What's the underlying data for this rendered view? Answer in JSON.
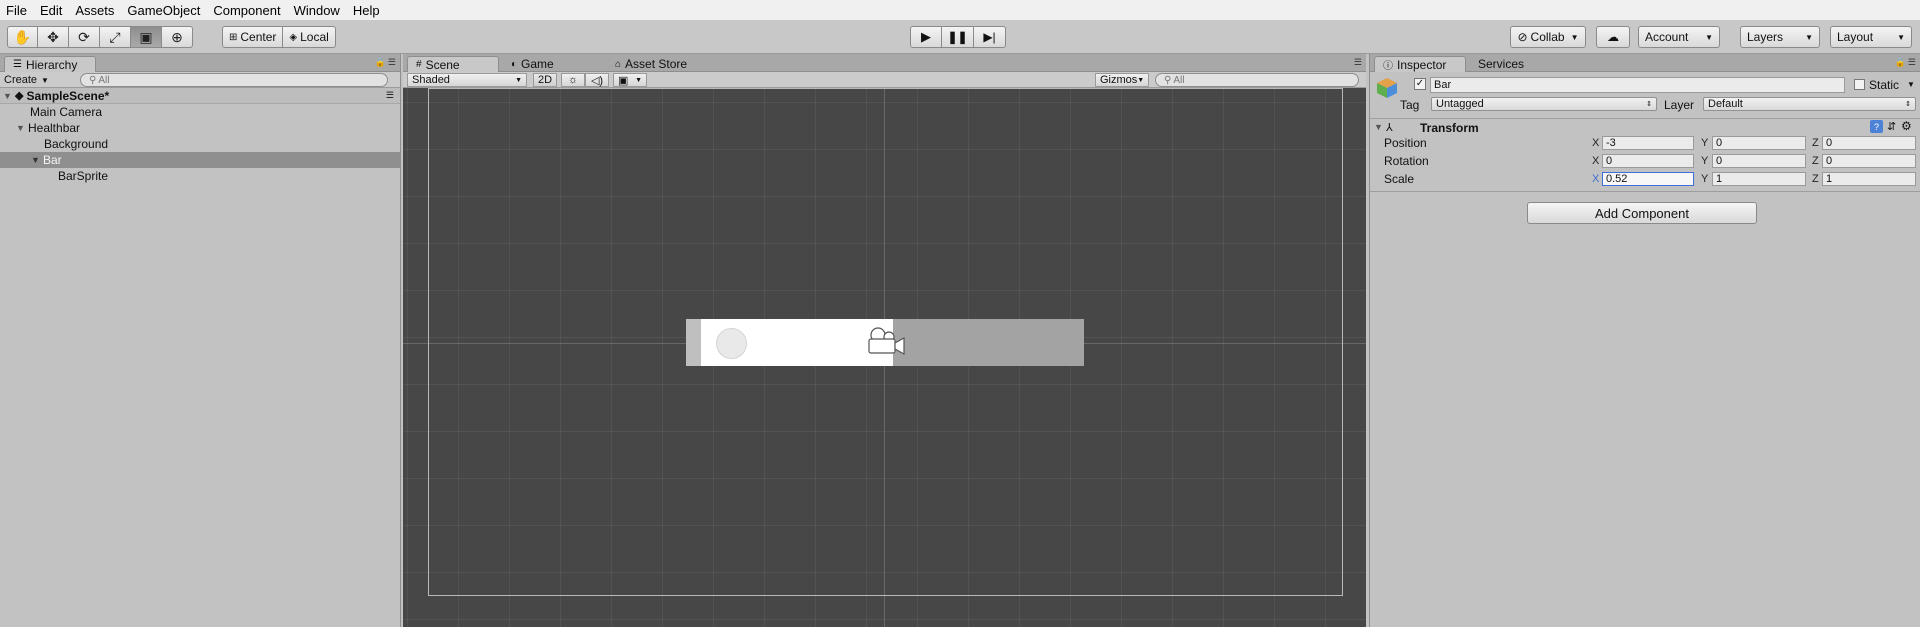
{
  "menu": [
    "File",
    "Edit",
    "Assets",
    "GameObject",
    "Component",
    "Window",
    "Help"
  ],
  "toolbar": {
    "pivot": "Center",
    "space": "Local",
    "collab": "Collab",
    "account": "Account",
    "layers": "Layers",
    "layout": "Layout"
  },
  "hierarchy": {
    "tab": "Hierarchy",
    "create": "Create",
    "search_placeholder": "All",
    "scene": "SampleScene*",
    "items": [
      {
        "label": "Main Camera"
      },
      {
        "label": "Healthbar"
      },
      {
        "label": "Background"
      },
      {
        "label": "Bar"
      },
      {
        "label": "BarSprite"
      }
    ]
  },
  "scene": {
    "tabs": [
      "Scene",
      "Game",
      "Asset Store"
    ],
    "shading": "Shaded",
    "mode_2d": "2D",
    "gizmos": "Gizmos",
    "search_placeholder": "All"
  },
  "healthbar": {
    "fill_fraction": 0.52
  },
  "inspector": {
    "tabs": [
      "Inspector",
      "Services"
    ],
    "object_name": "Bar",
    "static_label": "Static",
    "tag_label": "Tag",
    "tag_value": "Untagged",
    "layer_label": "Layer",
    "layer_value": "Default",
    "component": "Transform",
    "axis_x": "X",
    "axis_y": "Y",
    "axis_z": "Z",
    "position": {
      "label": "Position",
      "x": "-3",
      "y": "0",
      "z": "0"
    },
    "rotation": {
      "label": "Rotation",
      "x": "0",
      "y": "0",
      "z": "0"
    },
    "scale": {
      "label": "Scale",
      "x": "0.52",
      "y": "1",
      "z": "1"
    },
    "add_component": "Add Component"
  }
}
